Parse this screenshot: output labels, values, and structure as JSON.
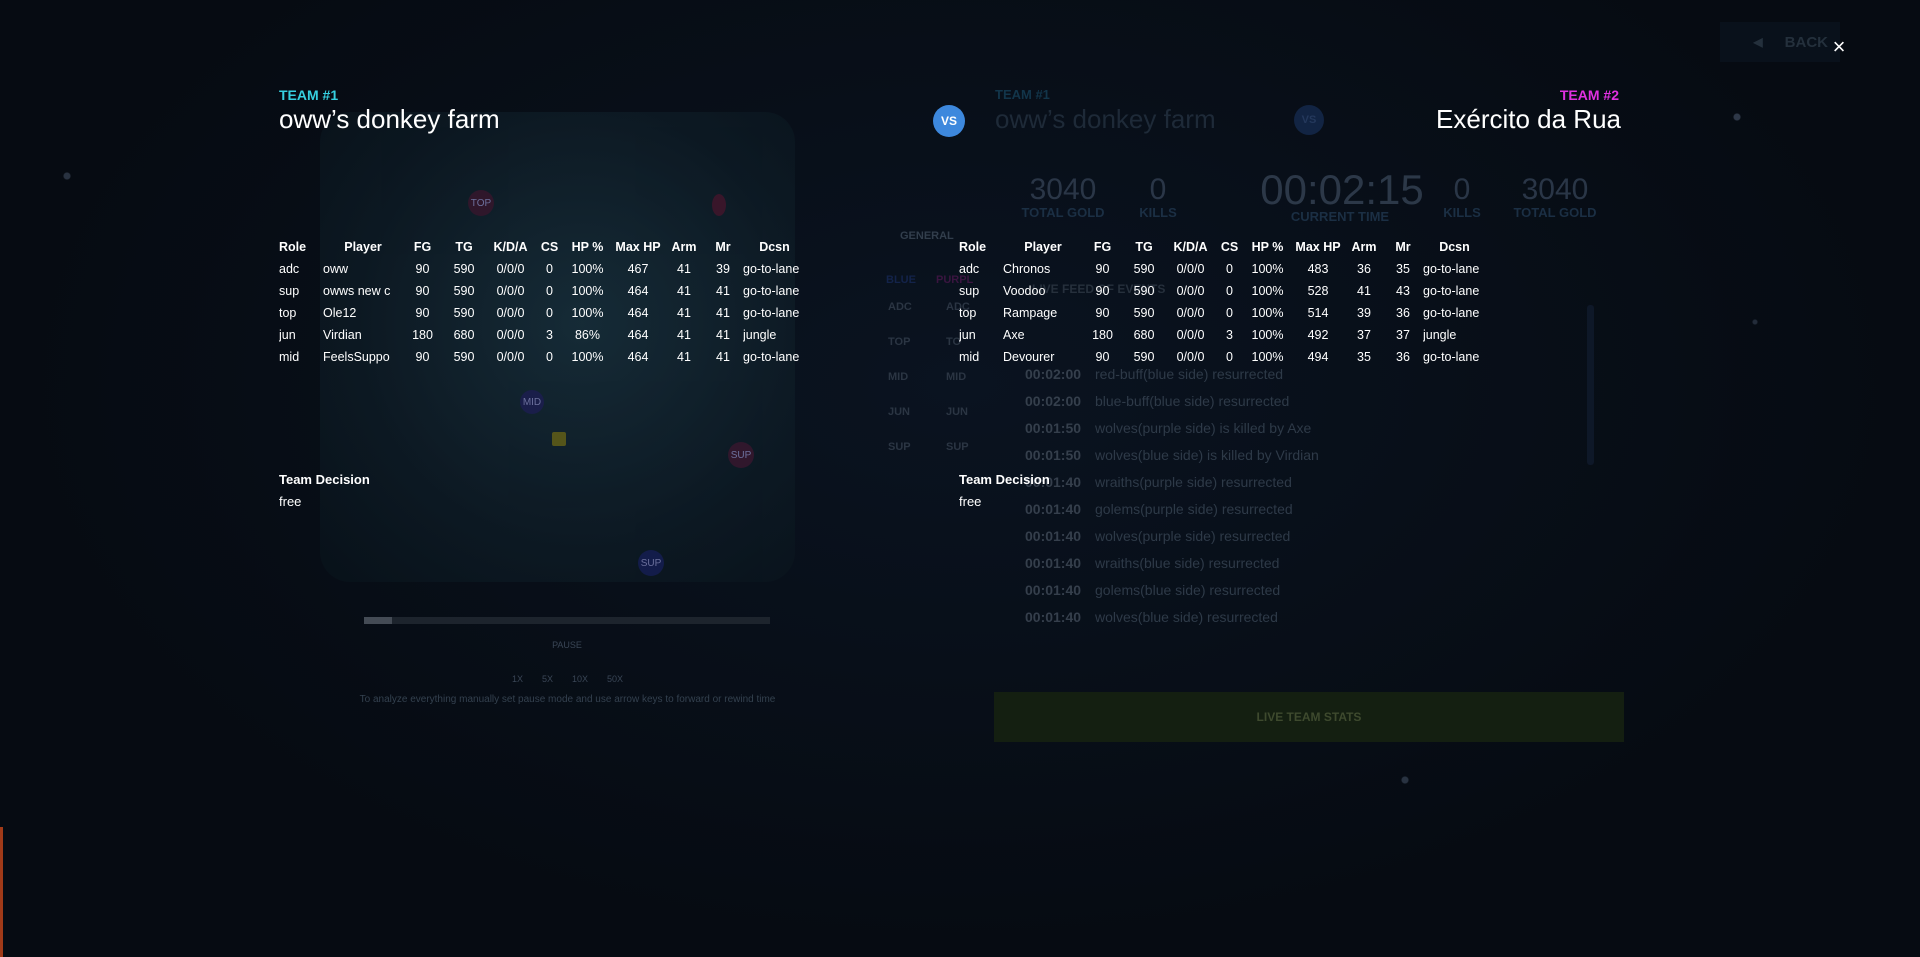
{
  "window": {
    "back_label": "BACK",
    "close_glyph": "×"
  },
  "team1": {
    "label": "TEAM #1",
    "name": "oww’s donkey farm",
    "label_color": "#36d0e0",
    "decision_title": "Team Decision",
    "decision_value": "free",
    "rows": [
      {
        "role": "adc",
        "player": "oww",
        "fg": "90",
        "tg": "590",
        "kda": "0/0/0",
        "cs": "0",
        "hp": "100%",
        "maxhp": "467",
        "arm": "41",
        "mr": "39",
        "dcsn": "go-to-lane"
      },
      {
        "role": "sup",
        "player": "owws new c",
        "fg": "90",
        "tg": "590",
        "kda": "0/0/0",
        "cs": "0",
        "hp": "100%",
        "maxhp": "464",
        "arm": "41",
        "mr": "41",
        "dcsn": "go-to-lane"
      },
      {
        "role": "top",
        "player": "Ole12",
        "fg": "90",
        "tg": "590",
        "kda": "0/0/0",
        "cs": "0",
        "hp": "100%",
        "maxhp": "464",
        "arm": "41",
        "mr": "41",
        "dcsn": "go-to-lane"
      },
      {
        "role": "jun",
        "player": "Virdian",
        "fg": "180",
        "tg": "680",
        "kda": "0/0/0",
        "cs": "3",
        "hp": "86%",
        "maxhp": "464",
        "arm": "41",
        "mr": "41",
        "dcsn": "jungle"
      },
      {
        "role": "mid",
        "player": "FeelsSuppo",
        "fg": "90",
        "tg": "590",
        "kda": "0/0/0",
        "cs": "0",
        "hp": "100%",
        "maxhp": "464",
        "arm": "41",
        "mr": "41",
        "dcsn": "go-to-lane"
      }
    ]
  },
  "team2": {
    "label": "TEAM #2",
    "name": "Exército da Rua",
    "label_color": "#e030e0",
    "decision_title": "Team Decision",
    "decision_value": "free",
    "rows": [
      {
        "role": "adc",
        "player": "Chronos",
        "fg": "90",
        "tg": "590",
        "kda": "0/0/0",
        "cs": "0",
        "hp": "100%",
        "maxhp": "483",
        "arm": "36",
        "mr": "35",
        "dcsn": "go-to-lane"
      },
      {
        "role": "sup",
        "player": "Voodoo",
        "fg": "90",
        "tg": "590",
        "kda": "0/0/0",
        "cs": "0",
        "hp": "100%",
        "maxhp": "528",
        "arm": "41",
        "mr": "43",
        "dcsn": "go-to-lane"
      },
      {
        "role": "top",
        "player": "Rampage",
        "fg": "90",
        "tg": "590",
        "kda": "0/0/0",
        "cs": "0",
        "hp": "100%",
        "maxhp": "514",
        "arm": "39",
        "mr": "36",
        "dcsn": "go-to-lane"
      },
      {
        "role": "jun",
        "player": "Axe",
        "fg": "180",
        "tg": "680",
        "kda": "0/0/0",
        "cs": "3",
        "hp": "100%",
        "maxhp": "492",
        "arm": "37",
        "mr": "37",
        "dcsn": "jungle"
      },
      {
        "role": "mid",
        "player": "Devourer",
        "fg": "90",
        "tg": "590",
        "kda": "0/0/0",
        "cs": "0",
        "hp": "100%",
        "maxhp": "494",
        "arm": "35",
        "mr": "36",
        "dcsn": "go-to-lane"
      }
    ]
  },
  "columns": [
    "Role",
    "Player",
    "FG",
    "TG",
    "K/D/A",
    "CS",
    "HP %",
    "Max HP",
    "Arm",
    "Mr",
    "Dcsn"
  ],
  "vs_label": "VS",
  "background": {
    "ghost_team_label": "TEAM #1",
    "ghost_team_name": "oww’s donkey farm",
    "left_gold": "3040",
    "left_gold_label": "TOTAL GOLD",
    "left_kills": "0",
    "left_kills_label": "KILLS",
    "current_time": "00:02:15",
    "current_time_label": "CURRENT TIME",
    "right_kills": "0",
    "right_kills_label": "KILLS",
    "right_gold": "3040",
    "right_gold_label": "TOTAL GOLD",
    "general_tab": "GENERAL",
    "blue_label": "BLUE",
    "purple_label": "PURPL",
    "side_roles_blue": [
      "ADC",
      "TOP",
      "MID",
      "JUN",
      "SUP"
    ],
    "side_roles_purple": [
      "ADC",
      "TO",
      "MID",
      "JUN",
      "SUP"
    ],
    "feed_title": "LIVE FEED OF EVENTS",
    "feed": [
      {
        "t": "00:02:00",
        "msg": "red-buff(blue side) resurrected"
      },
      {
        "t": "00:02:00",
        "msg": "blue-buff(blue side) resurrected"
      },
      {
        "t": "00:01:50",
        "msg": "wolves(purple side) is killed by Axe"
      },
      {
        "t": "00:01:50",
        "msg": "wolves(blue side) is killed by Virdian"
      },
      {
        "t": "00:01:40",
        "msg": "wraiths(purple side) resurrected"
      },
      {
        "t": "00:01:40",
        "msg": "golems(purple side) resurrected"
      },
      {
        "t": "00:01:40",
        "msg": "wolves(purple side) resurrected"
      },
      {
        "t": "00:01:40",
        "msg": "wraiths(blue side) resurrected"
      },
      {
        "t": "00:01:40",
        "msg": "golems(blue side) resurrected"
      },
      {
        "t": "00:01:40",
        "msg": "wolves(blue side) resurrected"
      }
    ],
    "live_stats_label": "LIVE TEAM STATS",
    "map_labels": {
      "top": "TOP",
      "mid": "MID",
      "sup": "SUP",
      "sup2": "SUP"
    },
    "replay": {
      "progress": 0.07,
      "pause_label": "PAUSE",
      "speeds": [
        "1X",
        "5X",
        "10X",
        "50X"
      ],
      "hint": "To analyze everything manually set pause mode and use arrow keys to forward or rewind time"
    }
  }
}
